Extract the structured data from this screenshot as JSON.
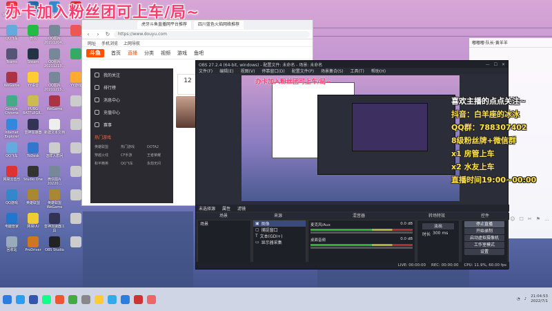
{
  "overlay_title": "办卡加入粉丝团可上车/局~",
  "desktop_icons": [
    {
      "label": "WPS Office",
      "color": "#d33"
    },
    {
      "label": "QQ",
      "color": "#26a"
    },
    {
      "label": "fileWebsit...",
      "color": "#38c"
    },
    {
      "label": "",
      "color": "#c22"
    },
    {
      "label": "QQ飞车",
      "color": "#6ad"
    },
    {
      "label": "微信",
      "color": "#2b4"
    },
    {
      "label": "QQ图片 20211204...",
      "color": "#789"
    },
    {
      "label": "",
      "color": "#e55"
    },
    {
      "label": "Teams",
      "color": "#557"
    },
    {
      "label": "Steam",
      "color": "#234"
    },
    {
      "label": "QQ图片 20211213...",
      "color": "#789"
    },
    {
      "label": "",
      "color": "#3a6"
    },
    {
      "label": "WeGame",
      "color": "#a34"
    },
    {
      "label": "YY语音",
      "color": "#fc3"
    },
    {
      "label": "QQ图片 20211215...",
      "color": "#789"
    },
    {
      "label": "YY游戏",
      "color": "#fa3"
    },
    {
      "label": "Google Chrome",
      "color": "#4a8"
    },
    {
      "label": "PUBG BATTLEGR...",
      "color": "#cb5"
    },
    {
      "label": "WeGame",
      "color": "#a34"
    },
    {
      "label": "",
      "color": "#ccc"
    },
    {
      "label": "Internet Explorer",
      "color": "#38d"
    },
    {
      "label": "雷神加速器",
      "color": "#335"
    },
    {
      "label": "新建文本文档",
      "color": "#eee"
    },
    {
      "label": "",
      "color": "#ccc"
    },
    {
      "label": "QQ飞车",
      "color": "#6ad"
    },
    {
      "label": "ToDesk",
      "color": "#37c"
    },
    {
      "label": "怎样入群问",
      "color": "#ccc"
    },
    {
      "label": "",
      "color": "#ccc"
    },
    {
      "label": "网易云音乐",
      "color": "#d33"
    },
    {
      "label": "Studio One",
      "color": "#333"
    },
    {
      "label": "微信图片 20220...",
      "color": "#789"
    },
    {
      "label": "",
      "color": "#ccc"
    },
    {
      "label": "QQ游戏",
      "color": "#38c"
    },
    {
      "label": "英雄联盟",
      "color": "#a83"
    },
    {
      "label": "英雄联盟 WeGame",
      "color": "#a83"
    },
    {
      "label": "",
      "color": "#ccc"
    },
    {
      "label": "电脑管家",
      "color": "#27c"
    },
    {
      "label": "网易UU",
      "color": "#ec3"
    },
    {
      "label": "雷神加速器工具",
      "color": "#335"
    },
    {
      "label": "",
      "color": "#ccc"
    },
    {
      "label": "回收站",
      "color": "#9ab"
    },
    {
      "label": "ProDriver",
      "color": "#c72"
    },
    {
      "label": "OBS Studio",
      "color": "#222"
    },
    {
      "label": "",
      "color": "#ccc"
    }
  ],
  "browser": {
    "tabs": [
      "虎牙斗鱼直播网平台推荐",
      "四川蓝色火焰网络推荐"
    ],
    "url": "https://www.douyu.com",
    "favorites": [
      "网址",
      "手机浏览",
      "上网导航"
    ],
    "logo": "斗鱼",
    "nav": [
      "首页",
      "直播",
      "分类",
      "视频",
      "游戏",
      "鱼吧"
    ],
    "sidebar": [
      "我的关注",
      "排行榜",
      "消息中心",
      "充值中心",
      "赛事"
    ],
    "sidebar_section": "热门游戏",
    "game_grid": [
      "英雄联盟",
      "热门游戏",
      "DOTA2",
      "穿越火线",
      "CF手游",
      "王者荣耀",
      "和平精英",
      "QQ飞车",
      "永劫无间"
    ],
    "card_num": "12"
  },
  "obs": {
    "title": "OBS 27.2.4 (64-bit, windows) - 配置文件: 未命名 - 场景: 未命名",
    "menu": [
      "文件(F)",
      "编辑(E)",
      "视图(V)",
      "停靠窗口(D)",
      "配置文件(P)",
      "场景集合(S)",
      "工具(T)",
      "帮助(H)"
    ],
    "status_strip": [
      "未选择源",
      "属性",
      "滤镜"
    ],
    "docks": [
      "场景",
      "来源",
      "混音器",
      "转场特效",
      "控件"
    ],
    "scenes": [
      "场景"
    ],
    "sources": [
      "图像",
      "捕捉窗口",
      "文本(GDI+)",
      "显示器采集"
    ],
    "mixer": [
      {
        "name": "麦克风/Aux",
        "level": "0.0 dB"
      },
      {
        "name": "桌面音频",
        "level": "0.0 dB"
      }
    ],
    "transition": {
      "type": "淡出",
      "duration_label": "时长",
      "duration": "300 ms"
    },
    "controls": [
      "停止直播",
      "开始录制",
      "启动虚拟摄像机",
      "工作室模式",
      "设置",
      "退出"
    ],
    "status": [
      "LIVE: 00:00:00",
      "REC: 00:00:00",
      "CPU: 11.9%, 60.00 fps"
    ]
  },
  "chat": {
    "header": "嘟嘟嘟·队长·黄羊羊",
    "tools": [
      "☺",
      "☐",
      "✂",
      "⚑",
      "…"
    ]
  },
  "promo": {
    "line1": "喜欢主播的点点关注~",
    "line2": "抖音：白羊座的冰冰",
    "line3": "QQ群：788307402",
    "line4": "8级粉丝牌+微信群",
    "line5": "x1 房管上车",
    "line6": "x2 水友上车",
    "line7": "直播时间19:00~00:00"
  },
  "taskbar": {
    "apps": [
      "#2a7de1",
      "#2a9df4",
      "#35a",
      "#1f8",
      "#e53",
      "#4a4",
      "#888",
      "#fc3",
      "#3ae",
      "#2a7de1",
      "#c33",
      "#e66"
    ],
    "time": "21:04:53",
    "date": "2022/7/1"
  }
}
